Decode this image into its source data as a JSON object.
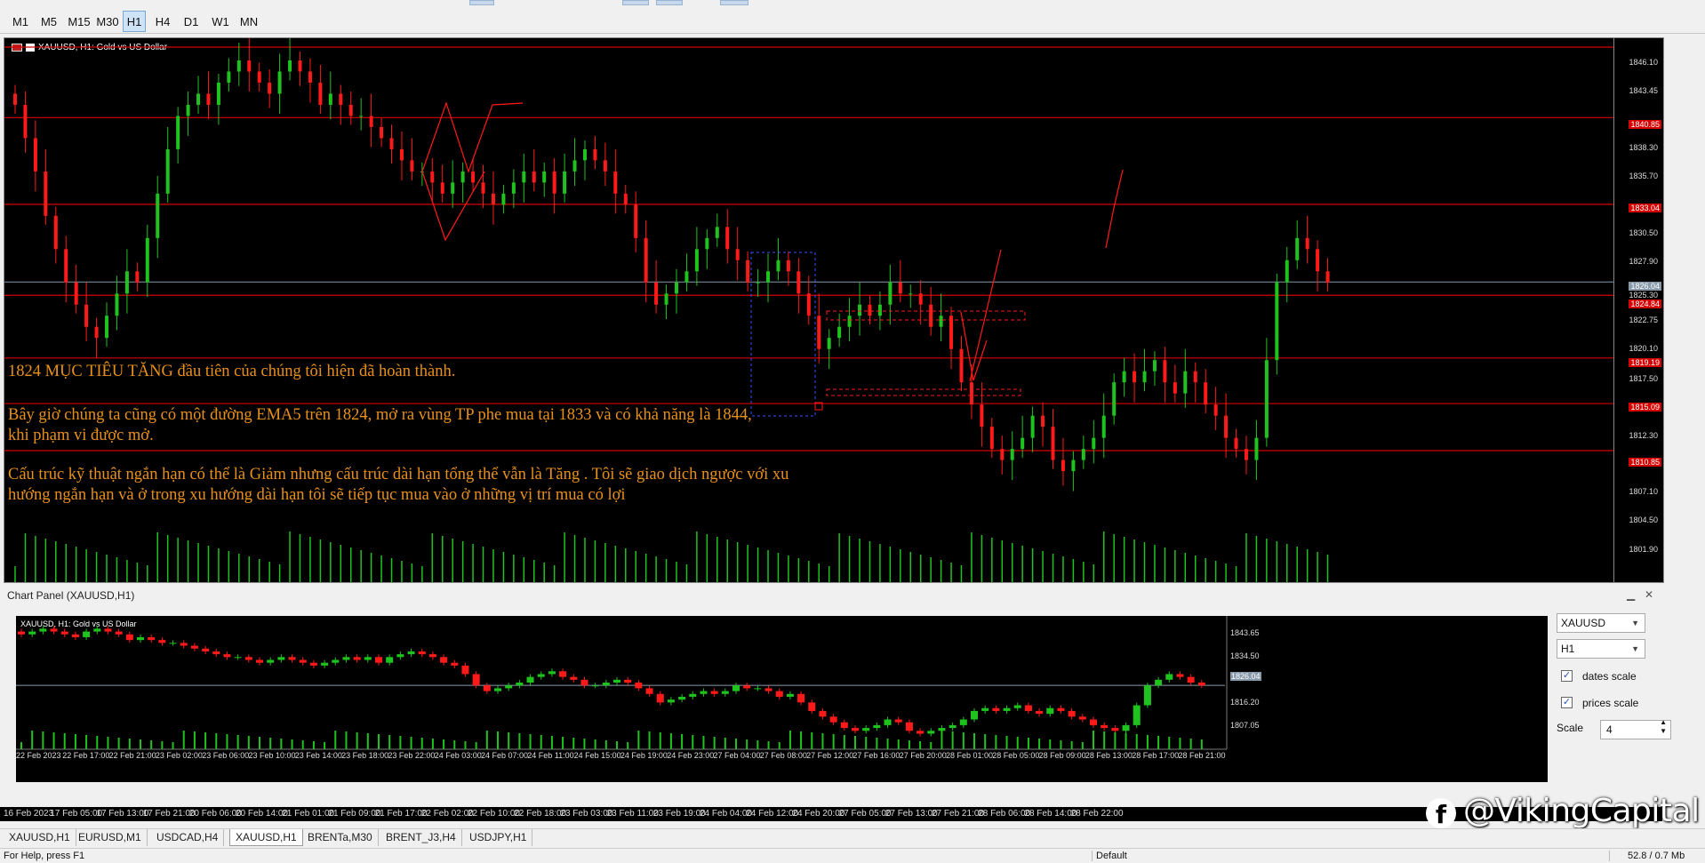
{
  "toolbar": {
    "timeframes": [
      "M1",
      "M5",
      "M15",
      "M30",
      "H1",
      "H4",
      "D1",
      "W1",
      "MN"
    ],
    "active": "H1"
  },
  "main_chart": {
    "title": "XAUUSD, H1:  Gold vs US Dollar",
    "price_labels": [
      "1846.10",
      "1843.45",
      "1838.30",
      "1835.70",
      "1830.50",
      "1827.90",
      "1825.30",
      "1822.75",
      "1820.10",
      "1817.50",
      "1812.30",
      "1807.10",
      "1804.50",
      "1801.90"
    ],
    "tags": {
      "t1": "1840.85",
      "t2": "1833.04",
      "t3": "1826.04",
      "t4": "1824.84",
      "t5": "1819.19",
      "t6": "1815.09",
      "t7": "1810.85"
    },
    "annotation_1": "1824 MỤC TIÊU TĂNG đầu tiên của chúng tôi hiện đã hoàn thành.",
    "annotation_2": "Bây giờ chúng ta cũng có một đường   EMA5 trên 1824, mở ra vùng TP phe mua tại 1833 và có khả năng là 1844,",
    "annotation_3": "khi phạm vi được mở.",
    "annotation_4": "Cấu trúc kỹ thuật ngắn hạn có thể là Giảm nhưng cấu trúc dài hạn tổng thể vẫn là Tăng . Tôi sẽ giao dịch ngược với xu",
    "annotation_5": "hướng ngắn hạn và ở trong xu hướng dài hạn  tôi sẽ tiếp tục mua vào ở những vị trí mua có lợi",
    "colors": {
      "bull": "#1ec31e",
      "bear": "#ff1a1a",
      "level": "#d40000",
      "annotation": "#e8901c"
    }
  },
  "panel": {
    "title": "Chart Panel (XAUUSD,H1)",
    "mini_title": "XAUUSD, H1:  Gold vs US Dollar",
    "mini_prices": [
      "1843.65",
      "1834.50",
      "1826.04",
      "1816.20",
      "1807.05"
    ],
    "mini_dates": [
      "22 Feb 2023",
      "22 Feb 17:00",
      "22 Feb 21:00",
      "23 Feb 02:00",
      "23 Feb 06:00",
      "23 Feb 10:00",
      "23 Feb 14:00",
      "23 Feb 18:00",
      "23 Feb 22:00",
      "24 Feb 03:00",
      "24 Feb 07:00",
      "24 Feb 11:00",
      "24 Feb 15:00",
      "24 Feb 19:00",
      "24 Feb 23:00",
      "27 Feb 04:00",
      "27 Feb 08:00",
      "27 Feb 12:00",
      "27 Feb 16:00",
      "27 Feb 20:00",
      "28 Feb 01:00",
      "28 Feb 05:00",
      "28 Feb 09:00",
      "28 Feb 13:00",
      "28 Feb 17:00",
      "28 Feb 21:00"
    ],
    "symbol": "XAUUSD",
    "timeframe": "H1",
    "dates_scale": "dates  scale",
    "prices_scale": "prices scale",
    "scale_label": "Scale",
    "scale_value": "4"
  },
  "date_axis": [
    "16 Feb 2023",
    "17 Feb 05:00",
    "17 Feb 13:00",
    "17 Feb 21:00",
    "20 Feb 06:00",
    "20 Feb 14:00",
    "21 Feb 01:00",
    "21 Feb 09:00",
    "21 Feb 17:00",
    "22 Feb 02:00",
    "22 Feb 10:00",
    "22 Feb 18:00",
    "23 Feb 03:00",
    "23 Feb 11:00",
    "23 Feb 19:00",
    "24 Feb 04:00",
    "24 Feb 12:00",
    "24 Feb 20:00",
    "27 Feb 05:00",
    "27 Feb 13:00",
    "27 Feb 21:00",
    "28 Feb 06:00",
    "28 Feb 14:00",
    "28 Feb 22:00"
  ],
  "tabs": [
    "XAUUSD,H1",
    "EURUSD,M1",
    "USDCAD,H4",
    "XAUUSD,H1",
    "BRENTa,M30",
    "BRENT_J3,H4",
    "USDJPY,H1"
  ],
  "active_tab_index": 3,
  "status": {
    "help": "For Help, press F1",
    "profile": "Default",
    "traffic": "52.8 / 0.7 Mb"
  },
  "watermark": "@VikingCapital"
}
